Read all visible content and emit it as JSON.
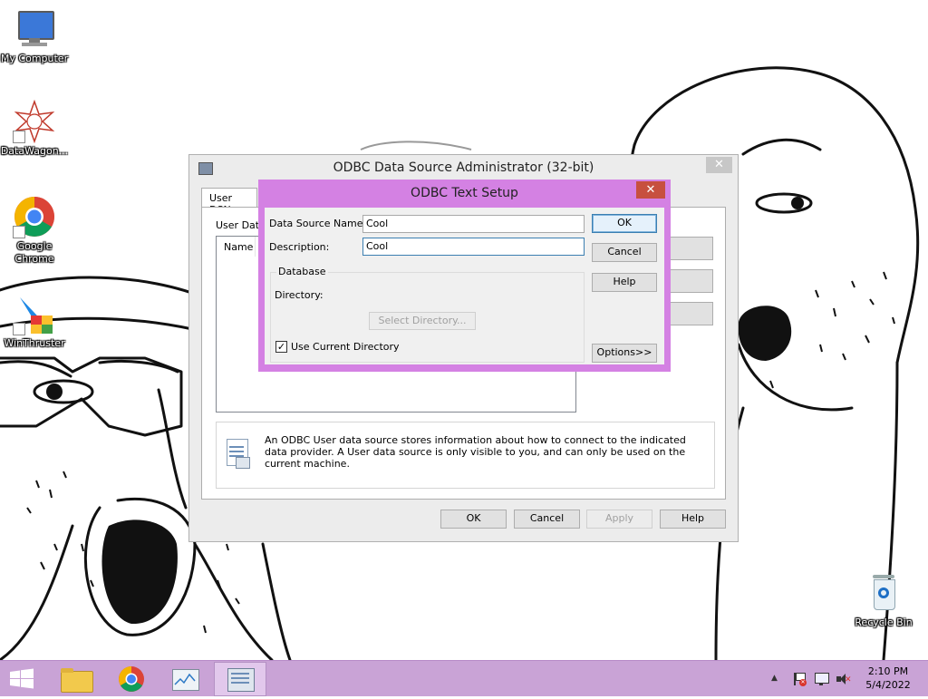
{
  "desktop": {
    "icons": [
      {
        "label": "My Computer"
      },
      {
        "label": "DataWagon..."
      },
      {
        "label": "Google Chrome"
      },
      {
        "label": "WinThruster"
      },
      {
        "label": "Recycle Bin"
      }
    ]
  },
  "admin_window": {
    "title": "ODBC Data Source Administrator (32-bit)",
    "tab_label": "User DSN",
    "list_caption": "User Data",
    "column_name": "Name",
    "info_text": "An ODBC User data source stores information about how to connect to the indicated data provider.   A User data source is only visible to you, and can only be used on the current machine.",
    "buttons": {
      "ok": "OK",
      "cancel": "Cancel",
      "apply": "Apply",
      "help": "Help"
    }
  },
  "text_setup": {
    "title": "ODBC Text Setup",
    "dsn_label": "Data Source Name:",
    "dsn_value": "Cool",
    "desc_label": "Description:",
    "desc_value": "Cool",
    "group_label": "Database",
    "directory_label": "Directory:",
    "select_dir_label": "Select Directory...",
    "use_current_label": "Use Current Directory",
    "use_current_checked": true,
    "buttons": {
      "ok": "OK",
      "cancel": "Cancel",
      "help": "Help",
      "options": "Options>>"
    }
  },
  "taskbar": {
    "time": "2:10 PM",
    "date": "5/4/2022"
  },
  "colors": {
    "taskbar": "#c9a3d6",
    "dialog_frame": "#d481e3",
    "close_button": "#c7503f"
  }
}
